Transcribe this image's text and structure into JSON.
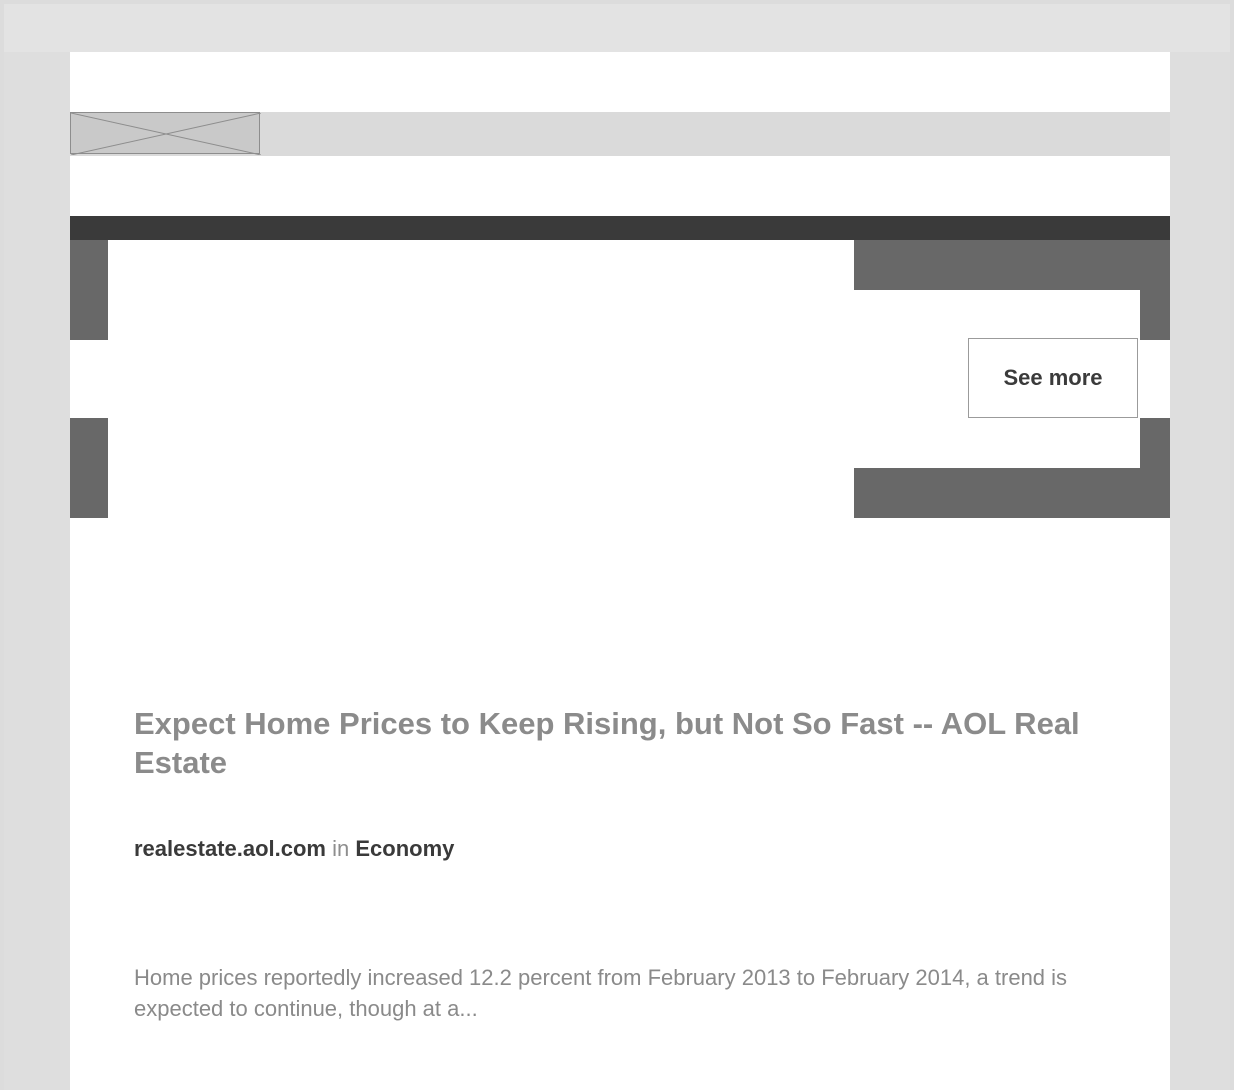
{
  "card": {
    "see_more_label": "See more",
    "title": "Expect Home Prices to Keep Rising, but Not So Fast -- AOL Real Estate",
    "source_domain": "realestate.aol.com",
    "source_connector": "in",
    "category": "Economy",
    "summary": "Home prices reportedly increased 12.2 percent from February 2013 to February 2014, a trend is expected to continue, though at a..."
  },
  "icons": {
    "placeholder_image": "broken-image-icon"
  },
  "colors": {
    "background": "#dcdcdc",
    "content_background": "#ffffff",
    "header_bar": "#3a3a3a",
    "shape_fill": "#686868",
    "title_text": "#8b8b8b",
    "meta_text": "#3a3a3a",
    "summary_text": "#8a8a8a"
  }
}
